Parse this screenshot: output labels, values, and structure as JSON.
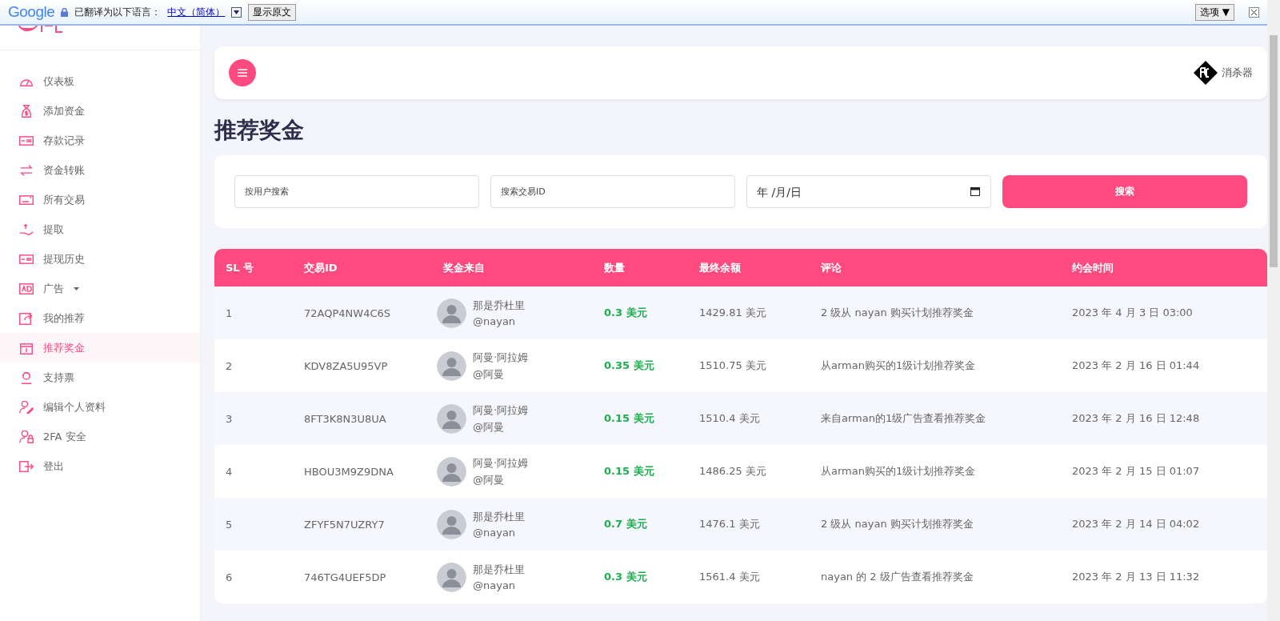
{
  "translate_bar": {
    "brand": "Google",
    "label": "已翻译为以下语言：",
    "language": "中文（简体）",
    "show_original_button": "显示原文",
    "options_button": "选项 ▼"
  },
  "sidebar": {
    "items": [
      {
        "label": "仪表板",
        "kind": "link",
        "selected": false
      },
      {
        "label": "添加资金",
        "kind": "link",
        "selected": false
      },
      {
        "label": "存款记录",
        "kind": "link",
        "selected": false
      },
      {
        "label": "资金转账",
        "kind": "link",
        "selected": false
      },
      {
        "label": "所有交易",
        "kind": "link",
        "selected": false
      },
      {
        "label": "提取",
        "kind": "link",
        "selected": false
      },
      {
        "label": "提现历史",
        "kind": "link",
        "selected": false
      },
      {
        "label": "广告",
        "kind": "dropdown",
        "selected": false
      },
      {
        "label": "我的推荐",
        "kind": "link",
        "selected": false
      },
      {
        "label": "推荐奖金",
        "kind": "link",
        "selected": true
      },
      {
        "label": "支持票",
        "kind": "link",
        "selected": false
      },
      {
        "label": "编辑个人资料",
        "kind": "link",
        "selected": false
      },
      {
        "label": "2FA 安全",
        "kind": "link",
        "selected": false
      },
      {
        "label": "登出",
        "kind": "link",
        "selected": false
      }
    ]
  },
  "header": {
    "user_name": "消杀器"
  },
  "page_title": "推荐奖金",
  "search": {
    "user_placeholder": "按用户搜索",
    "trx_placeholder": "搜索交易ID",
    "date_placeholder": "年 /月/日",
    "button": "搜索"
  },
  "table": {
    "columns": [
      "SL 号",
      "交易ID",
      "奖金来自",
      "数量",
      "最终余额",
      "评论",
      "约会时间"
    ],
    "rows": [
      {
        "sl": "1",
        "trx": "72AQP4NW4C6S",
        "name": "那是乔杜里",
        "handle": "@nayan",
        "amount": "0.3 美元",
        "balance": "1429.81 美元",
        "remark": "2 级从 nayan 购买计划推荐奖金",
        "date": "2023 年 4 月 3 日 03:00"
      },
      {
        "sl": "2",
        "trx": "KDV8ZA5U95VP",
        "name": "阿曼·阿拉姆",
        "handle": "@阿曼",
        "amount": "0.35 美元",
        "balance": "1510.75 美元",
        "remark": "从arman购买的1级计划推荐奖金",
        "date": "2023 年 2 月 16 日 01:44"
      },
      {
        "sl": "3",
        "trx": "8FT3K8N3U8UA",
        "name": "阿曼·阿拉姆",
        "handle": "@阿曼",
        "amount": "0.15 美元",
        "balance": "1510.4 美元",
        "remark": "来自arman的1级广告查看推荐奖金",
        "date": "2023 年 2 月 16 日 12:48"
      },
      {
        "sl": "4",
        "trx": "HBOU3M9Z9DNA",
        "name": "阿曼·阿拉姆",
        "handle": "@阿曼",
        "amount": "0.15 美元",
        "balance": "1486.25 美元",
        "remark": "从arman购买的1级计划推荐奖金",
        "date": "2023 年 2 月 15 日 01:07"
      },
      {
        "sl": "5",
        "trx": "ZFYF5N7UZRY7",
        "name": "那是乔杜里",
        "handle": "@nayan",
        "amount": "0.7 美元",
        "balance": "1476.1 美元",
        "remark": "2 级从 nayan 购买计划推荐奖金",
        "date": "2023 年 2 月 14 日 04:02"
      },
      {
        "sl": "6",
        "trx": "746TG4UEF5DP",
        "name": "那是乔杜里",
        "handle": "@nayan",
        "amount": "0.3 美元",
        "balance": "1561.4 美元",
        "remark": "nayan 的 2 级广告查看推荐奖金",
        "date": "2023 年 2 月 13 日 11:32"
      }
    ]
  }
}
